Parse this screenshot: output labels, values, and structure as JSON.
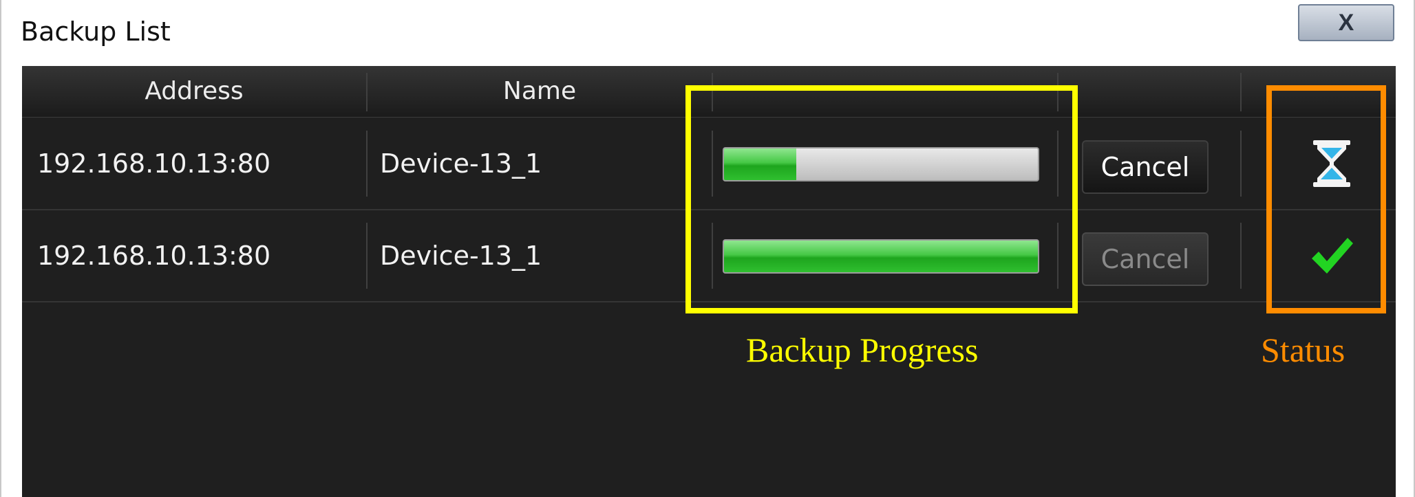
{
  "window": {
    "title": "Backup List",
    "close_label": "X"
  },
  "table": {
    "headers": [
      "Address",
      "Name",
      "",
      "",
      ""
    ],
    "rows": [
      {
        "address": "192.168.10.13:80",
        "name": "Device-13_1",
        "progress_percent": 23,
        "cancel_label": "Cancel",
        "cancel_enabled": true,
        "status_icon": "hourglass-icon"
      },
      {
        "address": "192.168.10.13:80",
        "name": "Device-13_1",
        "progress_percent": 100,
        "cancel_label": "Cancel",
        "cancel_enabled": false,
        "status_icon": "checkmark-icon"
      }
    ]
  },
  "annotations": {
    "progress_label": "Backup Progress",
    "status_label": "Status",
    "progress_color": "#ffff00",
    "status_color": "#ff8c00"
  }
}
